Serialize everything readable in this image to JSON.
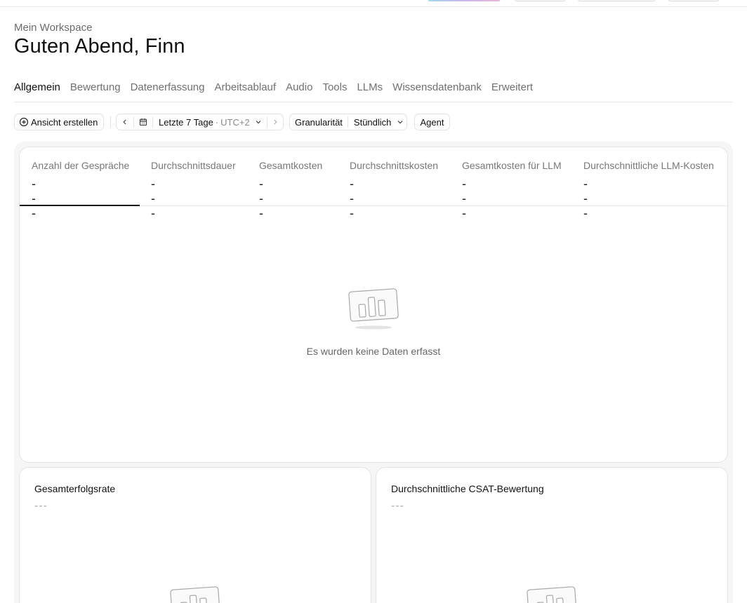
{
  "header": {
    "workspace": "Mein Workspace",
    "greeting": "Guten Abend, Finn"
  },
  "tabs": [
    {
      "label": "Allgemein",
      "active": true
    },
    {
      "label": "Bewertung"
    },
    {
      "label": "Datenerfassung"
    },
    {
      "label": "Arbeitsablauf"
    },
    {
      "label": "Audio"
    },
    {
      "label": "Tools"
    },
    {
      "label": "LLMs"
    },
    {
      "label": "Wissensdatenbank"
    },
    {
      "label": "Erweitert"
    }
  ],
  "filters": {
    "create_view_label": "Ansicht erstellen",
    "date_range": "Letzte 7 Tage",
    "date_separator": "·",
    "timezone": "UTC+2",
    "granularity_label": "Granularität",
    "granularity_value": "Stündlich",
    "agent_label": "Agent"
  },
  "metrics": [
    {
      "label": "Anzahl der Gespräche",
      "value": "---",
      "active": true
    },
    {
      "label": "Durchschnittsdauer",
      "value": "---"
    },
    {
      "label": "Gesamtkosten",
      "value": "---"
    },
    {
      "label": "Durchschnittskosten",
      "value": "---"
    },
    {
      "label": "Gesamtkosten für LLM",
      "value": "---"
    },
    {
      "label": "Durchschnittliche LLM-Kosten",
      "value": "---"
    }
  ],
  "main_chart": {
    "empty_text": "Es wurden keine Daten erfasst"
  },
  "sub_cards": [
    {
      "title": "Gesamterfolgsrate",
      "value": "---"
    },
    {
      "title": "Durchschnittliche CSAT-Bewertung",
      "value": "---"
    }
  ],
  "colors": {
    "accent": "#111111",
    "muted_text": "#707070",
    "border": "#e3e3e3",
    "panel_bg": "#f6f6f6"
  },
  "icons": {
    "create_view": "plus-circle-icon",
    "prev": "chevron-left-icon",
    "calendar": "calendar-icon",
    "dropdown": "chevron-down-icon",
    "next": "chevron-right-icon",
    "empty_state": "bar-chart-empty-icon"
  }
}
